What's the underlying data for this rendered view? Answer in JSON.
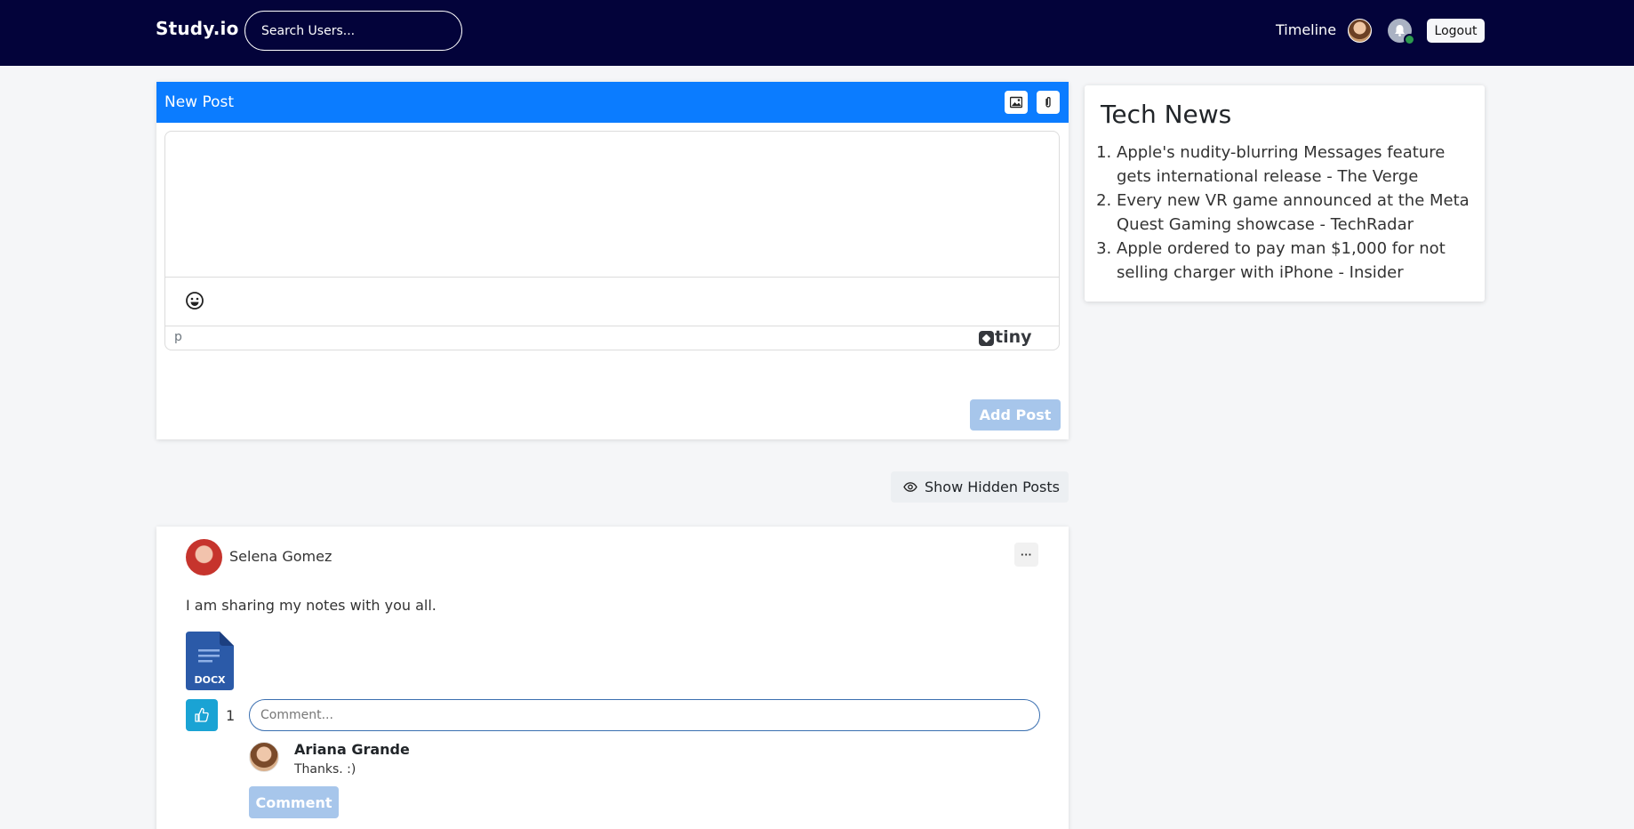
{
  "navbar": {
    "brand": "Study.io",
    "search_placeholder": "Search Users...",
    "timeline_label": "Timeline",
    "logout_label": "Logout",
    "online_status_color": "#2e9c4e",
    "background": "#03033a"
  },
  "new_post": {
    "title": "New Post",
    "header_icons": [
      "image-icon",
      "paperclip-icon"
    ],
    "editor_path": "p",
    "editor_brand": "tiny",
    "add_post_label": "Add Post",
    "accent": "#0b7cff"
  },
  "tech_news": {
    "title": "Tech News",
    "items": [
      "Apple's nudity-blurring Messages feature gets international release - The Verge",
      "Every new VR game announced at the Meta Quest Gaming showcase - TechRadar",
      "Apple ordered to pay man $1,000 for not selling charger with iPhone - Insider"
    ]
  },
  "feed": {
    "show_hidden_label": "Show Hidden Posts",
    "posts": [
      {
        "author": "Selena Gomez",
        "text": "I am sharing my notes with you all.",
        "attachment_type": "DOCX",
        "like_count": "1",
        "comment_placeholder": "Comment...",
        "comment_button_label": "Comment",
        "comments": [
          {
            "author": "Ariana Grande",
            "text": "Thanks. :)"
          }
        ]
      }
    ]
  }
}
